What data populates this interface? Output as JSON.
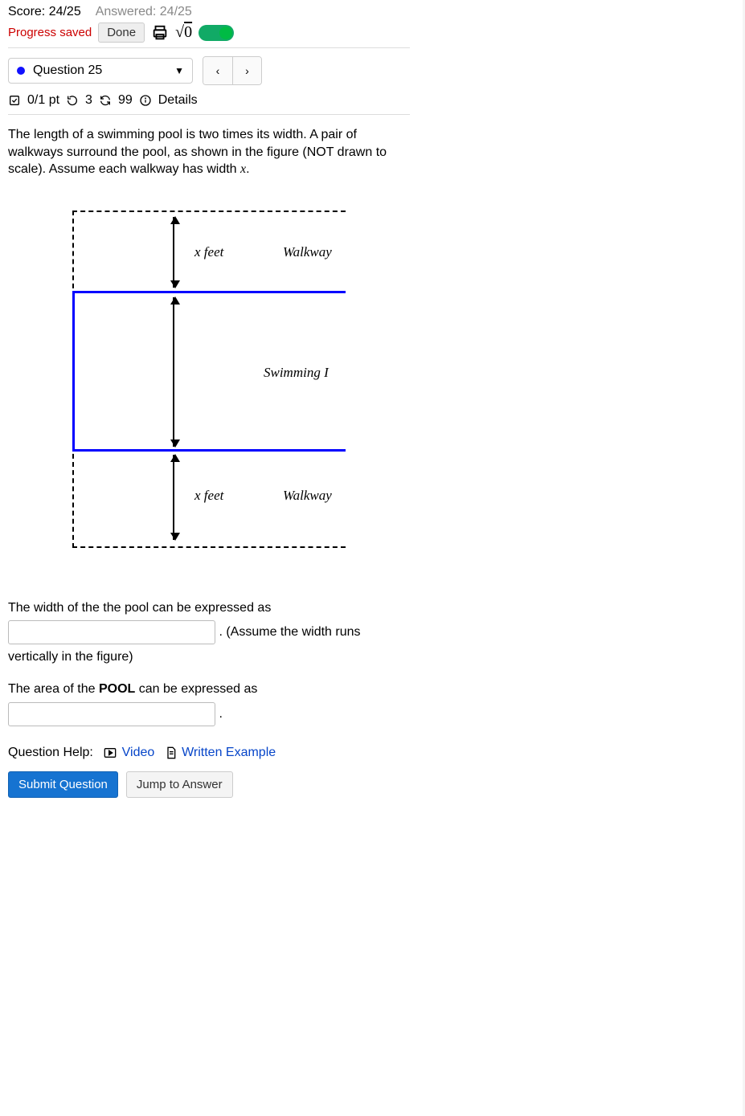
{
  "top": {
    "score": "Score: 24/25",
    "answered": "Answered: 24/25",
    "saved": "Progress saved",
    "done": "Done"
  },
  "nav": {
    "question_label": "Question 25",
    "prev": "‹",
    "next": "›"
  },
  "meta": {
    "points": "0/1 pt",
    "retries": "3",
    "reattempts": "99",
    "details": "Details"
  },
  "prompt": {
    "text_a": "The length of a swimming pool is two times its width. A pair of walkways surround the pool, as shown in the figure (NOT drawn to scale). Assume each walkway has width ",
    "text_b": "."
  },
  "figure": {
    "xfeet": "x feet",
    "walkway": "Walkway",
    "pool": "Swimming I"
  },
  "q": {
    "width_a": "The width of the the pool can be expressed as",
    "width_b": " .  (Assume the width runs",
    "width_c": "vertically in the figure)",
    "area_a": "The area of the ",
    "area_pool": "POOL",
    "area_b": " can be expressed as",
    "dot": "."
  },
  "help": {
    "label": "Question Help:",
    "video": "Video",
    "written": "Written Example"
  },
  "actions": {
    "submit": "Submit Question",
    "jump": "Jump to Answer"
  }
}
